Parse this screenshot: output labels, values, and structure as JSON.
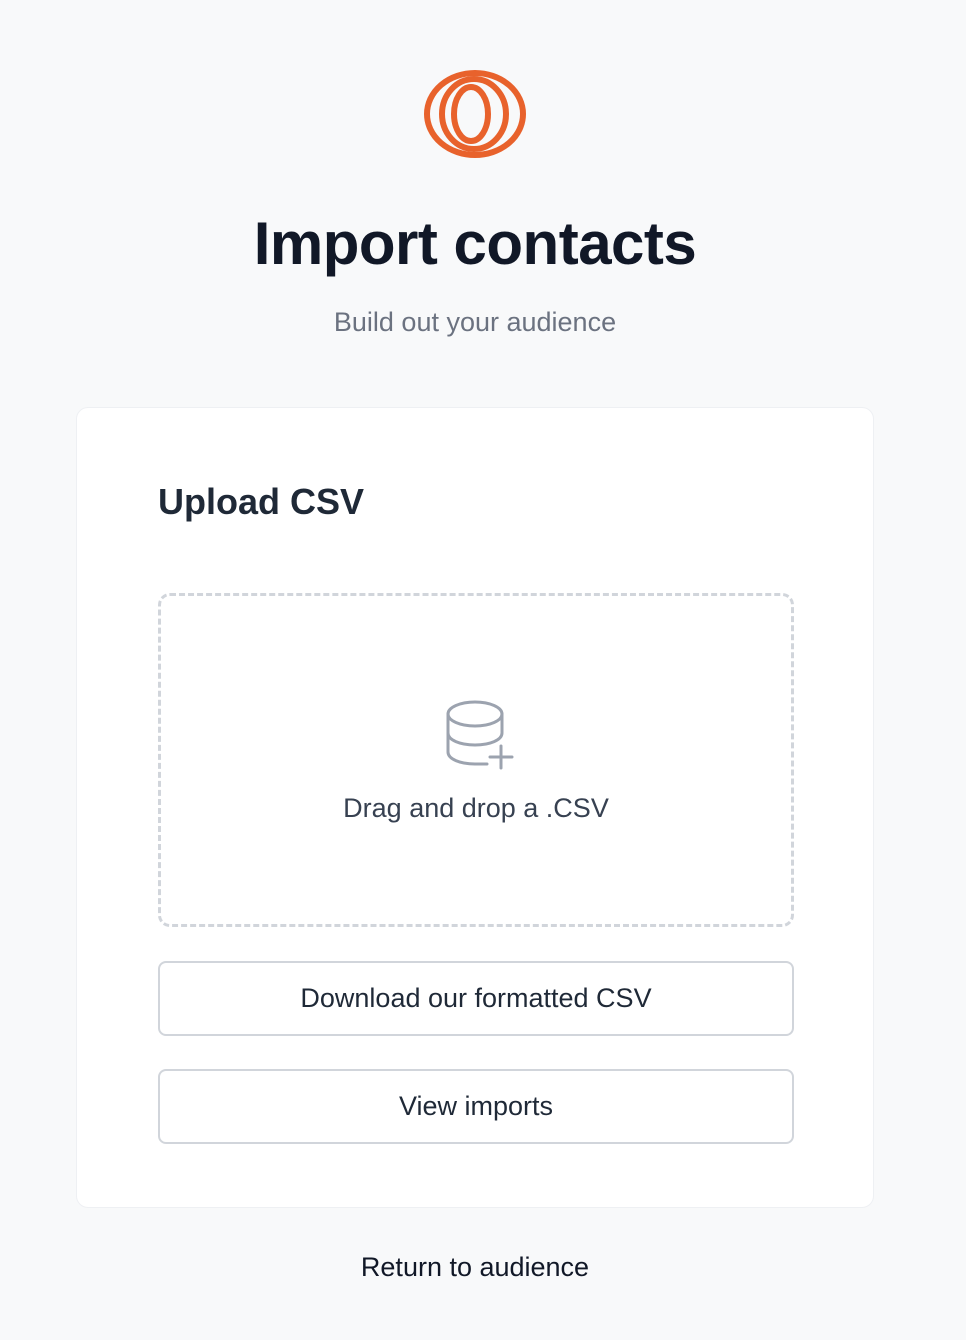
{
  "brand": {
    "logo_icon": "concentric-rings-logo-icon",
    "accent_color": "#e8622c"
  },
  "header": {
    "title": "Import contacts",
    "subtitle": "Build out your audience"
  },
  "upload_card": {
    "title": "Upload CSV",
    "dropzone": {
      "icon": "database-add-icon",
      "label": "Drag and drop a .CSV"
    },
    "download_button_label": "Download our formatted CSV",
    "view_imports_button_label": "View imports"
  },
  "footer": {
    "return_link_label": "Return to audience"
  }
}
